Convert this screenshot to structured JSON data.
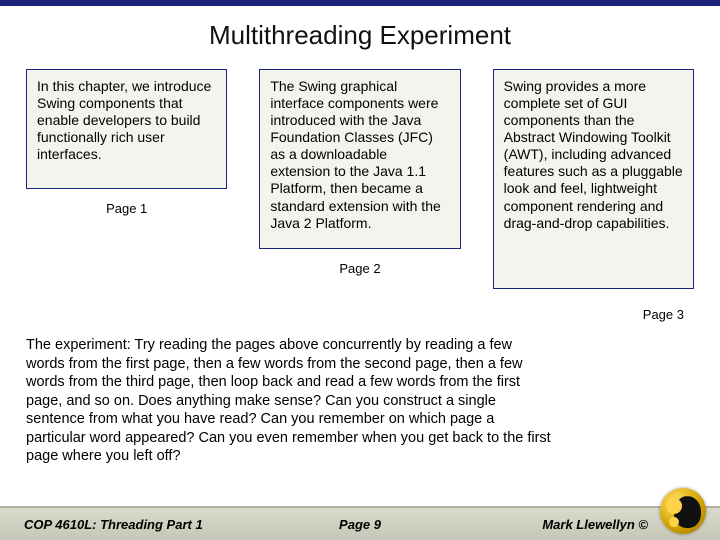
{
  "title": "Multithreading Experiment",
  "cards": [
    {
      "text": "In this chapter, we introduce Swing components that enable developers to build functionally rich user interfaces.",
      "label": "Page 1"
    },
    {
      "text": "The Swing graphical interface components were introduced with the Java Foundation Classes (JFC) as a downloadable extension to the Java 1.1 Platform, then became a standard extension with the Java 2 Platform.",
      "label": "Page 2"
    },
    {
      "text": "Swing provides a more complete set of GUI components than the Abstract Windowing Toolkit (AWT), including advanced features such as a pluggable look and feel, lightweight component rendering and drag-and-drop capabilities.",
      "label": "Page 3"
    }
  ],
  "experiment": "The experiment:   Try reading the pages above concurrently by reading a few words from the first page, then a few words from the second page, then a few words from the third page, then loop back and read a few words from the first page, and so on.  Does anything make sense?  Can you construct a single sentence from what you have read?  Can you remember on which page a particular word appeared?  Can you even remember when you get back to the first page where you left off?",
  "footer": {
    "left": "COP 4610L: Threading Part 1",
    "center": "Page 9",
    "right": "Mark Llewellyn ©"
  }
}
